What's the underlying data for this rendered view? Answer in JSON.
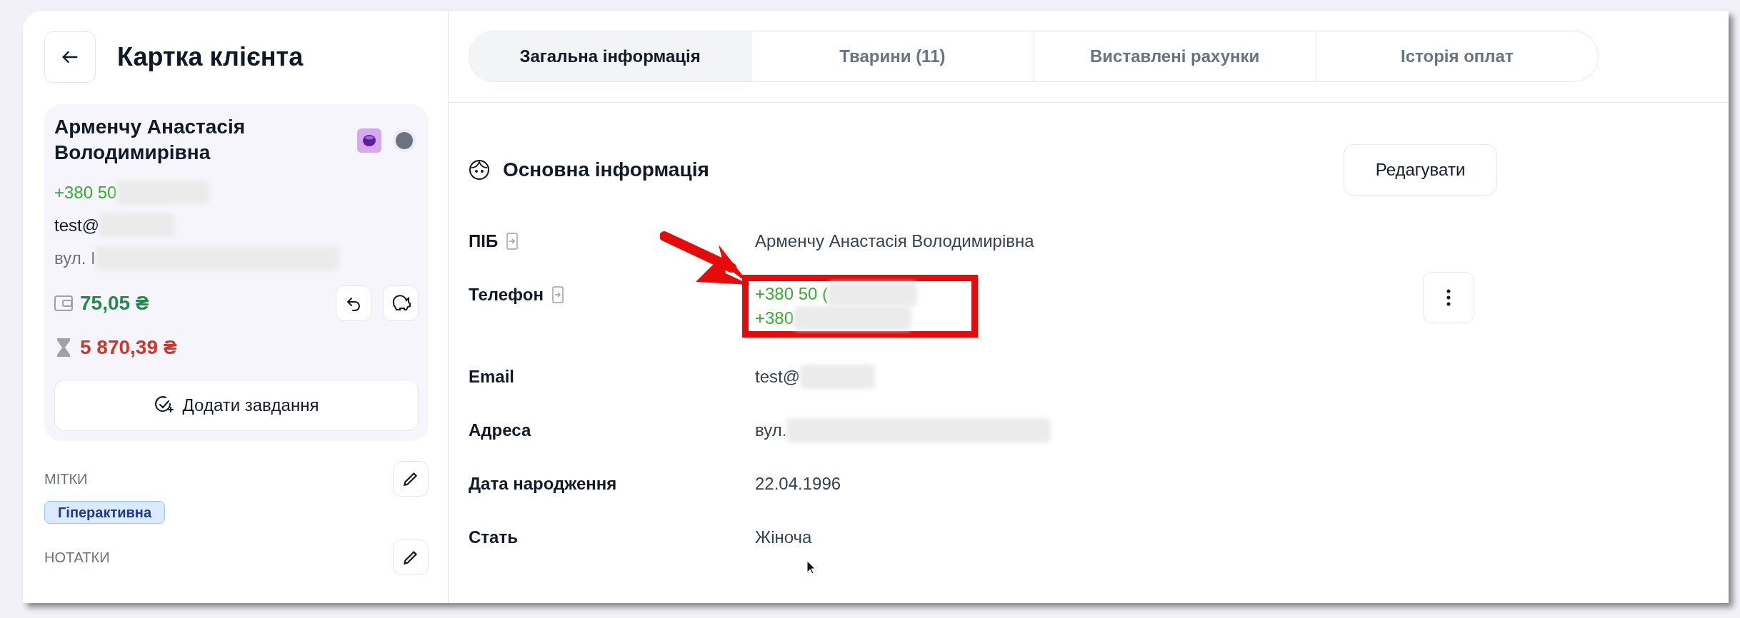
{
  "header": {
    "title": "Картка клієнта"
  },
  "client": {
    "name": "Арменчу Анастасія Володимирівна",
    "phone": "+380 50",
    "email": "test@",
    "address": "вул. І",
    "balance": "75,05 ₴",
    "debt": "5 870,39 ₴",
    "add_task": "Додати завдання"
  },
  "tags_section": {
    "label": "МІТКИ",
    "tags": [
      "Гіперактивна"
    ]
  },
  "notes_section": {
    "label": "НОТАТКИ"
  },
  "tabs": [
    {
      "label": "Загальна інформація",
      "selected": true
    },
    {
      "label": "Тварини (11)",
      "selected": false
    },
    {
      "label": "Виставлені рахунки",
      "selected": false
    },
    {
      "label": "Історія оплат",
      "selected": false
    }
  ],
  "section": {
    "title": "Основна інформація",
    "edit_button": "Редагувати"
  },
  "fields": [
    {
      "label": "ПІБ",
      "copy": true,
      "kind": "text",
      "values": [
        "Арменчу Анастасія Володимирівна"
      ]
    },
    {
      "label": "Телефон",
      "copy": true,
      "kind": "phone",
      "values": [
        "+380 50 (",
        "+380"
      ]
    },
    {
      "label": "Email",
      "copy": false,
      "kind": "text",
      "values": [
        "test@"
      ]
    },
    {
      "label": "Адреса",
      "copy": false,
      "kind": "text",
      "values": [
        "вул."
      ]
    },
    {
      "label": "Дата народження",
      "copy": false,
      "kind": "text",
      "values": [
        "22.04.1996"
      ]
    },
    {
      "label": "Стать",
      "copy": false,
      "kind": "text",
      "values": [
        "Жіноча"
      ]
    }
  ]
}
